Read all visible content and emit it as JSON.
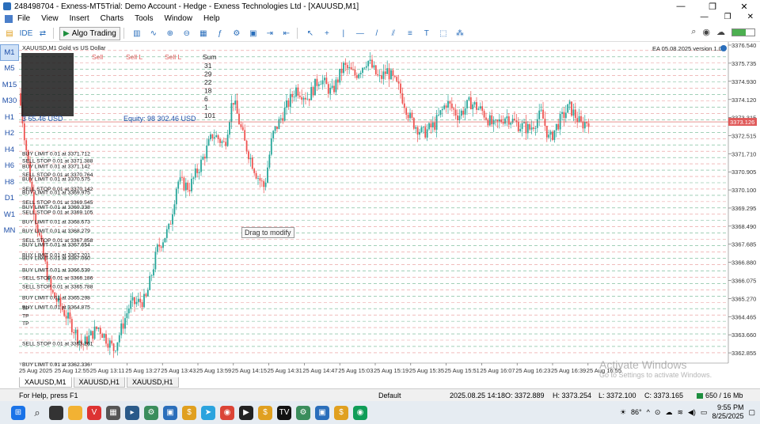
{
  "window": {
    "title": "248498704 - Exness-MT5Trial: Demo Account - Hedge - Exness Technologies Ltd - [XAUUSD,M1]",
    "minimize": "—",
    "maximize": "❐",
    "close": "✕"
  },
  "menu": [
    "File",
    "View",
    "Insert",
    "Charts",
    "Tools",
    "Window",
    "Help"
  ],
  "menu_right": {
    "min": "—",
    "restore": "❐",
    "close": "✕"
  },
  "toolbar": {
    "ide_label": "IDE",
    "algo_label": "Algo Trading"
  },
  "timeframes": [
    "M1",
    "M5",
    "M15",
    "M30",
    "H1",
    "H2",
    "H4",
    "H6",
    "H8",
    "D1",
    "W1",
    "MN"
  ],
  "active_timeframe": "M1",
  "chart": {
    "symbol_label": "XAUUSD,M1 Gold vs US Dollar",
    "ea_label": "EA 05.08.2025 version 1.05",
    "price_marker": "3373.126",
    "tooltip": "Drag to modify",
    "equity_left": "3 65.46 USD",
    "equity_right": "Equity: 98 302.46 USD",
    "summary_header": [
      "Sell",
      "Sell L",
      "Sell L",
      "Sum"
    ],
    "summary_sums": [
      "31",
      "29",
      "22",
      "18",
      "6",
      "1",
      "101"
    ],
    "orders": [
      "BUY LIMIT 0.01 at 3371.712",
      "SELL STOP 0.01 at 3371.388",
      "BUY LIMIT 0.01 at 3371.142",
      "SELL STOP 0.01 at 3370.764",
      "BUY LIMIT 0.01 at 3370.575",
      "SELL STOP 0.01 at 3370.142",
      "BUY LIMIT 0.01 at 3369.975",
      "SELL STOP 0.01 at 3369.545",
      "BUY LIMIT 0.01 at 3369.338",
      "SELL STOP 0.01 at 3369.105",
      "BUY LIMIT 0.01 at 3368.673",
      "BUY LIMIT 0.01 at 3368.279",
      "SELL STOP 0.01 at 3367.858",
      "BUY LIMIT 0.01 at 3367.654",
      "BUY LIMIT 0.01 at 3367.201",
      "BUY LIMIT 0.01 at 3367.060",
      "BUY LIMIT 0.01 at 3366.539",
      "SELL STOP 0.01 at 3366.186",
      "SELL STOP 0.01 at 3365.788",
      "BUY LIMIT 0.01 at 3365.298",
      "BUY LIMIT 0.01 at 3364.875",
      "TP",
      "TP",
      "TP",
      "SELL STOP 0.01 at 3363.261",
      "BUY LIMIT 0.01 at 3362.336"
    ]
  },
  "price_axis": [
    "3376.540",
    "3375.735",
    "3374.930",
    "3374.120",
    "3373.315",
    "3372.515",
    "3371.710",
    "3370.905",
    "3370.100",
    "3369.295",
    "3368.490",
    "3367.685",
    "3366.880",
    "3366.075",
    "3365.270",
    "3364.465",
    "3363.660",
    "3362.855"
  ],
  "time_axis": [
    "25 Aug 2025",
    "25 Aug 12:55",
    "25 Aug 13:11",
    "25 Aug 13:27",
    "25 Aug 13:43",
    "25 Aug 13:59",
    "25 Aug 14:15",
    "25 Aug 14:31",
    "25 Aug 14:47",
    "25 Aug 15:03",
    "25 Aug 15:19",
    "25 Aug 15:35",
    "25 Aug 15:51",
    "25 Aug 16:07",
    "25 Aug 16:23",
    "25 Aug 16:39",
    "25 Aug 16:55"
  ],
  "chart_tabs": [
    "XAUUSD,M1",
    "XAUUSD,H1",
    "XAUUSD,H1"
  ],
  "status": {
    "help": "For Help, press F1",
    "profile": "Default",
    "datetime": "2025.08.25 14:18",
    "open": "O: 3372.889",
    "high": "H: 3373.254",
    "low": "L: 3372.100",
    "close": "C: 3373.165",
    "traffic": "650 / 16 Mb"
  },
  "activate": {
    "title": "Activate Windows",
    "subtitle": "Go to Settings to activate Windows."
  },
  "taskbar": {
    "temp": "86°",
    "time": "9:55 PM",
    "date": "8/25/2025"
  },
  "colors": {
    "bull": "#26a69a",
    "bear": "#ef5350",
    "sell_line": "#e07070",
    "buy_line": "#3a9a6a",
    "accent": "#2a6ebb"
  }
}
